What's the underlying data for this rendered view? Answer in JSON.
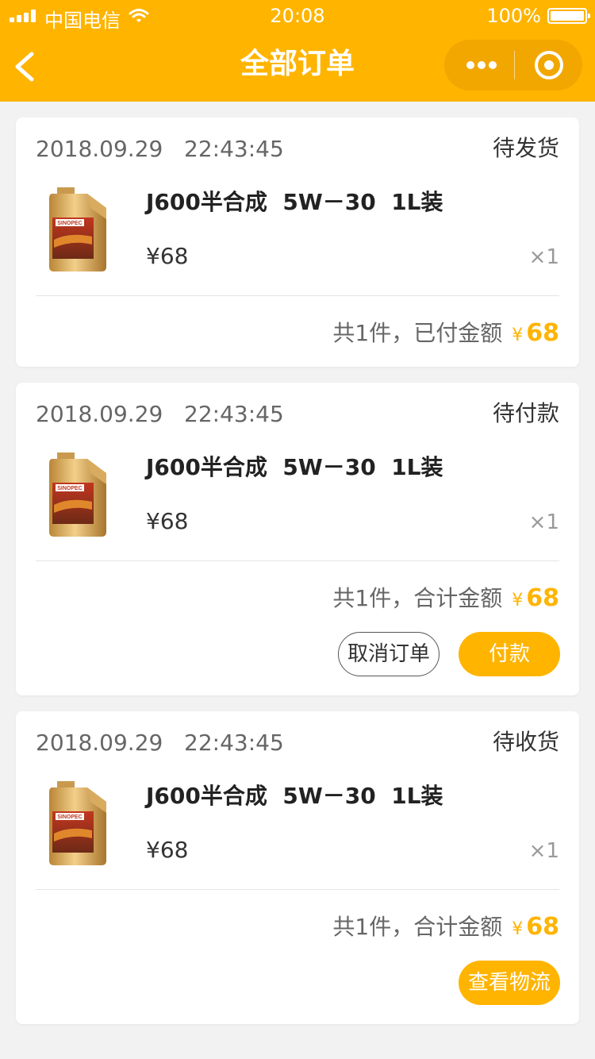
{
  "status_bar": {
    "carrier": "中国电信",
    "time": "20:08",
    "battery": "100%"
  },
  "nav": {
    "title": "全部订单",
    "back_icon": "chevron-left-icon",
    "more_icon": "more-dots-icon",
    "close_icon": "target-icon"
  },
  "colors": {
    "brand": "#ffb400",
    "background": "#f2f2f2"
  },
  "orders": [
    {
      "time": "2018.09.29   22:43:45",
      "status": "待发货",
      "product_name": "J600半合成  5W－30  1L装",
      "price": "¥68",
      "qty": "×1",
      "summary_text": "共1件，已付金额",
      "currency": "¥",
      "amount": "68"
    },
    {
      "time": "2018.09.29   22:43:45",
      "status": "待付款",
      "product_name": "J600半合成  5W－30  1L装",
      "price": "¥68",
      "qty": "×1",
      "summary_text": "共1件，合计金额",
      "currency": "¥",
      "amount": "68",
      "cancel_label": "取消订单",
      "pay_label": "付款"
    },
    {
      "time": "2018.09.29   22:43:45",
      "status": "待收货",
      "product_name": "J600半合成  5W－30  1L装",
      "price": "¥68",
      "qty": "×1",
      "summary_text": "共1件，合计金额",
      "currency": "¥",
      "amount": "68",
      "logistics_label": "查看物流"
    }
  ],
  "product_image": {
    "brand_text": "SINOPEC"
  }
}
